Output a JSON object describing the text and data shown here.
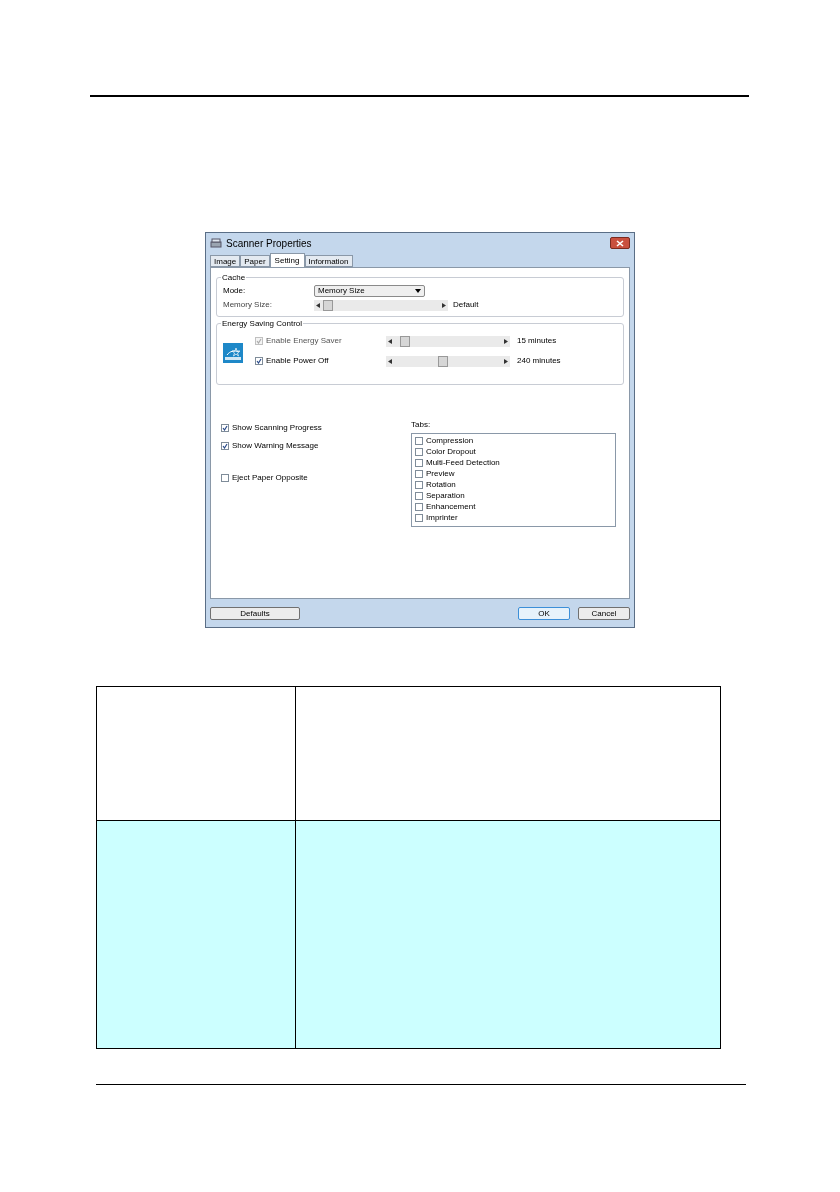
{
  "window": {
    "title": "Scanner Properties"
  },
  "tabs": [
    {
      "label": "Image",
      "selected": false
    },
    {
      "label": "Paper",
      "selected": false
    },
    {
      "label": "Setting",
      "selected": true
    },
    {
      "label": "Information",
      "selected": false
    }
  ],
  "cache": {
    "title": "Cache",
    "mode_label": "Mode:",
    "mode_value": "Memory Size",
    "memory_size": {
      "label": "Memory Size:",
      "level": 0.05,
      "reading": "Default"
    }
  },
  "energy": {
    "title": "Energy Saving Control",
    "rows": [
      {
        "label": "Enable Energy Saver",
        "checked": true,
        "disabled": true,
        "level": 0.1,
        "reading": "15 minutes"
      },
      {
        "label": "Enable Power Off",
        "checked": true,
        "disabled": false,
        "level": 0.45,
        "reading": "240 minutes"
      }
    ]
  },
  "options": [
    {
      "label": "Show Scanning Progress",
      "checked": true
    },
    {
      "label": "Show Warning Message",
      "checked": true
    },
    {
      "label": "Eject Paper Opposite",
      "checked": false
    }
  ],
  "tab_list": {
    "label": "Tabs:",
    "items": [
      {
        "label": "Compression",
        "checked": false
      },
      {
        "label": "Color Dropout",
        "checked": false
      },
      {
        "label": "Multi-Feed Detection",
        "checked": false
      },
      {
        "label": "Preview",
        "checked": false
      },
      {
        "label": "Rotation",
        "checked": false
      },
      {
        "label": "Separation",
        "checked": false
      },
      {
        "label": "Enhancement",
        "checked": false
      },
      {
        "label": "Imprinter",
        "checked": false
      }
    ]
  },
  "buttons": [
    {
      "label": "Defaults",
      "default": false
    },
    {
      "label": "OK",
      "default": true
    },
    {
      "label": "Cancel",
      "default": false
    }
  ],
  "table": {
    "rows": [
      {
        "highlighted": false
      },
      {
        "highlighted": true
      }
    ]
  }
}
